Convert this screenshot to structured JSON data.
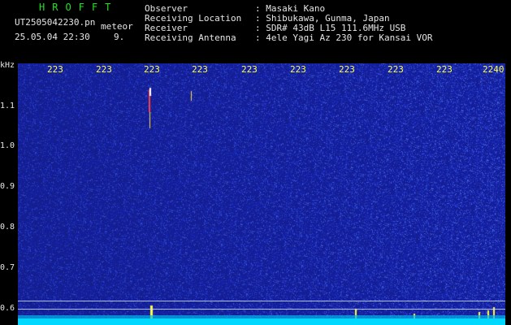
{
  "header": {
    "brand": "HROFFT",
    "filename": "UT2505042230.pn",
    "mode": "meteor",
    "datetime": "25.05.04 22:30",
    "number": "9.",
    "info": [
      {
        "key": "Observer",
        "value": ": Masaki Kano"
      },
      {
        "key": "Receiving Location",
        "value": ": Shibukawa, Gunma, Japan"
      },
      {
        "key": "Receiver",
        "value": ": SDR# 43dB L15 111.6MHz USB"
      },
      {
        "key": "Receiving Antenna",
        "value": ": 4ele Yagi Az 230 for Kansai VOR"
      }
    ]
  },
  "axis": {
    "unit": "kHz",
    "y_labels": [
      "1.1",
      "1.0",
      "0.9",
      "0.8",
      "0.7",
      "0.6"
    ],
    "time_labels": [
      "223",
      "223",
      "223",
      "223",
      "223",
      "223",
      "223",
      "223",
      "223",
      "2240"
    ]
  },
  "colors": {
    "background": "#0a1a8a",
    "time_label": "#ffff40",
    "brand": "#22e022",
    "text": "#e6e6e6",
    "baseline": "#00d8ff"
  }
}
